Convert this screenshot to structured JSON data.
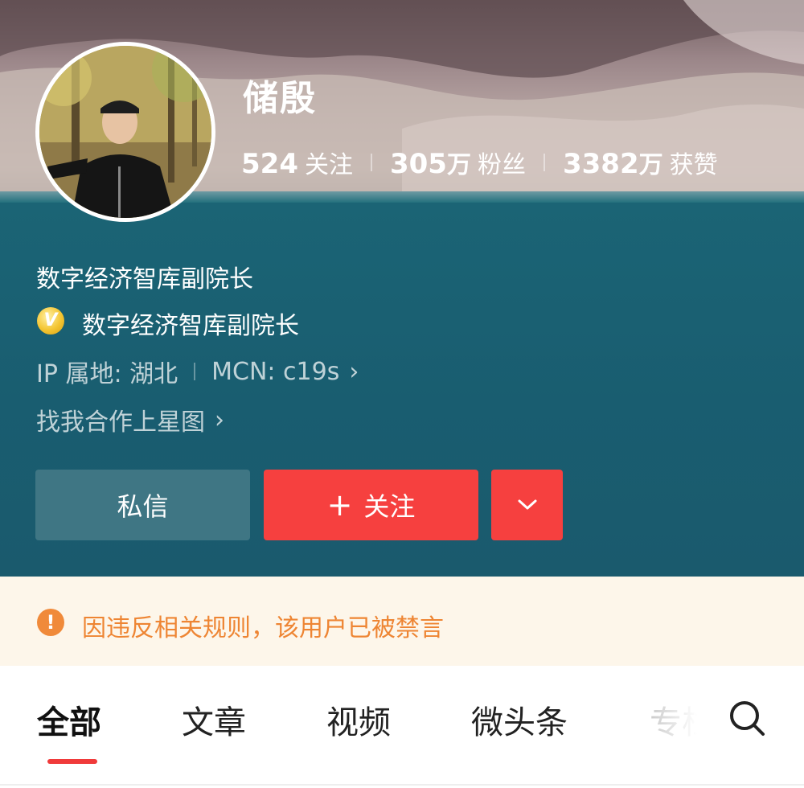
{
  "profile": {
    "name": "储殷",
    "stats": [
      {
        "num": "524",
        "unit": "",
        "label": "关注"
      },
      {
        "num": "305",
        "unit": "万",
        "label": "粉丝"
      },
      {
        "num": "3382",
        "unit": "万",
        "label": "获赞"
      }
    ],
    "bio": "数字经济智库副院长",
    "verification": "数字经济智库副院长",
    "verify_icon_glyph": "V",
    "ip_location": "IP 属地: 湖北",
    "mcn": "MCN: c19s",
    "cooperation": "找我合作上星图",
    "chevron": "›"
  },
  "actions": {
    "message_label": "私信",
    "follow_plus": "+",
    "follow_label": "关注",
    "more_icon": "chevron-down-icon"
  },
  "notice": {
    "icon_glyph": "!",
    "text": "因违反相关规则，该用户已被禁言"
  },
  "tabs": {
    "items": [
      "全部",
      "文章",
      "视频",
      "微头条",
      "专栏"
    ],
    "active_index": 0
  },
  "colors": {
    "accent_red": "#f6403f",
    "notice_orange": "#ee8533",
    "header_teal": "#1b6475"
  }
}
